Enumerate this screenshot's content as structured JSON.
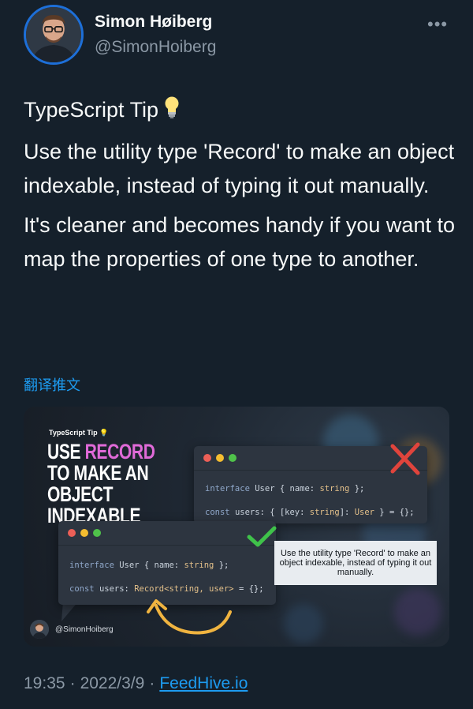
{
  "author": {
    "display_name": "Simon Høiberg",
    "handle": "@SimonHoiberg"
  },
  "tweet": {
    "title": "TypeScript Tip",
    "title_icon": "lightbulb-icon",
    "paragraphs": [
      "Use the utility type 'Record' to make an object indexable, instead of typing it out manually.",
      "It's cleaner and becomes handy if you want to map the properties of one type to another."
    ],
    "translate_label": "翻译推文"
  },
  "media": {
    "tip_label": "TypeScript Tip",
    "headline": {
      "part1": "USE ",
      "highlight": "RECORD",
      "part2": " TO MAKE AN OBJECT INDEXABLE"
    },
    "bad_code": {
      "line1": {
        "kw": "interface",
        "name": "User",
        "open": " { ",
        "prop": "name",
        "colon": ": ",
        "type": "string",
        "close": " };"
      },
      "line2": {
        "kw": "const",
        "name": "users",
        "mid": ": { [",
        "key": "key",
        "colon": ": ",
        "ktype": "string",
        "rest": "]: ",
        "vtype": "User",
        "end": " } = {};"
      }
    },
    "good_code": {
      "line1": {
        "kw": "interface",
        "name": "User",
        "open": " { ",
        "prop": "name",
        "colon": ": ",
        "type": "string",
        "close": " };"
      },
      "line2": {
        "kw": "const",
        "name": "users",
        "colon": ": ",
        "type": "Record<string, user>",
        "end": " = {};"
      }
    },
    "caption": "Use the utility type 'Record' to make an object indexable, instead of typing it out manually.",
    "author_handle": "@SimonHoiberg",
    "colors": {
      "highlight": "#e06ad8",
      "cross": "#e0443c",
      "check": "#3fc24a",
      "arrow": "#f0b440"
    }
  },
  "meta": {
    "time": "19:35",
    "separator": "·",
    "date": "2022/3/9",
    "source": "FeedHive.io"
  },
  "colors": {
    "background": "#15202b",
    "link": "#1d9bf0",
    "muted": "#8b98a5",
    "avatar_ring": "#1d6fd8"
  }
}
